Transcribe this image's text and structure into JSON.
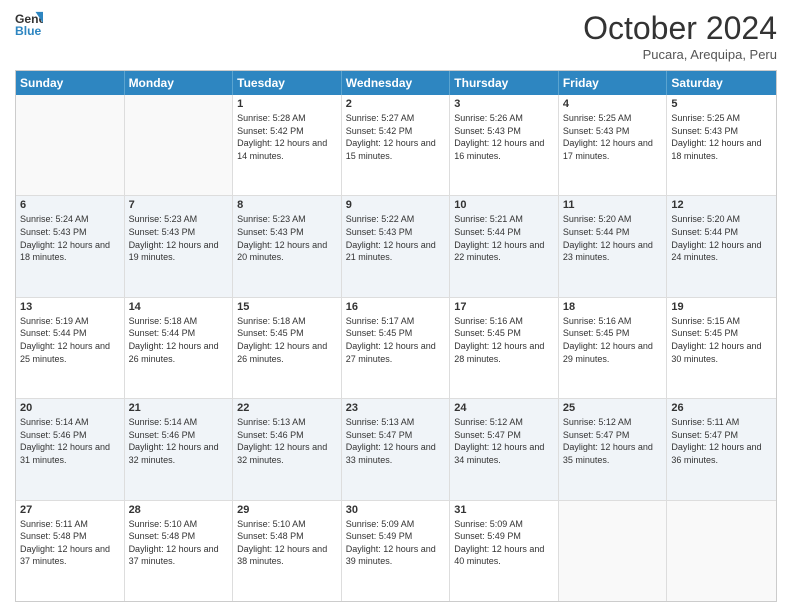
{
  "logo": {
    "line1": "General",
    "line2": "Blue"
  },
  "title": "October 2024",
  "location": "Pucara, Arequipa, Peru",
  "days_of_week": [
    "Sunday",
    "Monday",
    "Tuesday",
    "Wednesday",
    "Thursday",
    "Friday",
    "Saturday"
  ],
  "weeks": [
    [
      {
        "day": "",
        "sunrise": "",
        "sunset": "",
        "daylight": "",
        "empty": true
      },
      {
        "day": "",
        "sunrise": "",
        "sunset": "",
        "daylight": "",
        "empty": true
      },
      {
        "day": "1",
        "sunrise": "5:28 AM",
        "sunset": "5:42 PM",
        "daylight": "12 hours and 14 minutes."
      },
      {
        "day": "2",
        "sunrise": "5:27 AM",
        "sunset": "5:42 PM",
        "daylight": "12 hours and 15 minutes."
      },
      {
        "day": "3",
        "sunrise": "5:26 AM",
        "sunset": "5:43 PM",
        "daylight": "12 hours and 16 minutes."
      },
      {
        "day": "4",
        "sunrise": "5:25 AM",
        "sunset": "5:43 PM",
        "daylight": "12 hours and 17 minutes."
      },
      {
        "day": "5",
        "sunrise": "5:25 AM",
        "sunset": "5:43 PM",
        "daylight": "12 hours and 18 minutes."
      }
    ],
    [
      {
        "day": "6",
        "sunrise": "5:24 AM",
        "sunset": "5:43 PM",
        "daylight": "12 hours and 18 minutes."
      },
      {
        "day": "7",
        "sunrise": "5:23 AM",
        "sunset": "5:43 PM",
        "daylight": "12 hours and 19 minutes."
      },
      {
        "day": "8",
        "sunrise": "5:23 AM",
        "sunset": "5:43 PM",
        "daylight": "12 hours and 20 minutes."
      },
      {
        "day": "9",
        "sunrise": "5:22 AM",
        "sunset": "5:43 PM",
        "daylight": "12 hours and 21 minutes."
      },
      {
        "day": "10",
        "sunrise": "5:21 AM",
        "sunset": "5:44 PM",
        "daylight": "12 hours and 22 minutes."
      },
      {
        "day": "11",
        "sunrise": "5:20 AM",
        "sunset": "5:44 PM",
        "daylight": "12 hours and 23 minutes."
      },
      {
        "day": "12",
        "sunrise": "5:20 AM",
        "sunset": "5:44 PM",
        "daylight": "12 hours and 24 minutes."
      }
    ],
    [
      {
        "day": "13",
        "sunrise": "5:19 AM",
        "sunset": "5:44 PM",
        "daylight": "12 hours and 25 minutes."
      },
      {
        "day": "14",
        "sunrise": "5:18 AM",
        "sunset": "5:44 PM",
        "daylight": "12 hours and 26 minutes."
      },
      {
        "day": "15",
        "sunrise": "5:18 AM",
        "sunset": "5:45 PM",
        "daylight": "12 hours and 26 minutes."
      },
      {
        "day": "16",
        "sunrise": "5:17 AM",
        "sunset": "5:45 PM",
        "daylight": "12 hours and 27 minutes."
      },
      {
        "day": "17",
        "sunrise": "5:16 AM",
        "sunset": "5:45 PM",
        "daylight": "12 hours and 28 minutes."
      },
      {
        "day": "18",
        "sunrise": "5:16 AM",
        "sunset": "5:45 PM",
        "daylight": "12 hours and 29 minutes."
      },
      {
        "day": "19",
        "sunrise": "5:15 AM",
        "sunset": "5:45 PM",
        "daylight": "12 hours and 30 minutes."
      }
    ],
    [
      {
        "day": "20",
        "sunrise": "5:14 AM",
        "sunset": "5:46 PM",
        "daylight": "12 hours and 31 minutes."
      },
      {
        "day": "21",
        "sunrise": "5:14 AM",
        "sunset": "5:46 PM",
        "daylight": "12 hours and 32 minutes."
      },
      {
        "day": "22",
        "sunrise": "5:13 AM",
        "sunset": "5:46 PM",
        "daylight": "12 hours and 32 minutes."
      },
      {
        "day": "23",
        "sunrise": "5:13 AM",
        "sunset": "5:47 PM",
        "daylight": "12 hours and 33 minutes."
      },
      {
        "day": "24",
        "sunrise": "5:12 AM",
        "sunset": "5:47 PM",
        "daylight": "12 hours and 34 minutes."
      },
      {
        "day": "25",
        "sunrise": "5:12 AM",
        "sunset": "5:47 PM",
        "daylight": "12 hours and 35 minutes."
      },
      {
        "day": "26",
        "sunrise": "5:11 AM",
        "sunset": "5:47 PM",
        "daylight": "12 hours and 36 minutes."
      }
    ],
    [
      {
        "day": "27",
        "sunrise": "5:11 AM",
        "sunset": "5:48 PM",
        "daylight": "12 hours and 37 minutes."
      },
      {
        "day": "28",
        "sunrise": "5:10 AM",
        "sunset": "5:48 PM",
        "daylight": "12 hours and 37 minutes."
      },
      {
        "day": "29",
        "sunrise": "5:10 AM",
        "sunset": "5:48 PM",
        "daylight": "12 hours and 38 minutes."
      },
      {
        "day": "30",
        "sunrise": "5:09 AM",
        "sunset": "5:49 PM",
        "daylight": "12 hours and 39 minutes."
      },
      {
        "day": "31",
        "sunrise": "5:09 AM",
        "sunset": "5:49 PM",
        "daylight": "12 hours and 40 minutes."
      },
      {
        "day": "",
        "sunrise": "",
        "sunset": "",
        "daylight": "",
        "empty": true
      },
      {
        "day": "",
        "sunrise": "",
        "sunset": "",
        "daylight": "",
        "empty": true
      }
    ]
  ],
  "labels": {
    "sunrise_prefix": "Sunrise: ",
    "sunset_prefix": "Sunset: ",
    "daylight_prefix": "Daylight: "
  }
}
